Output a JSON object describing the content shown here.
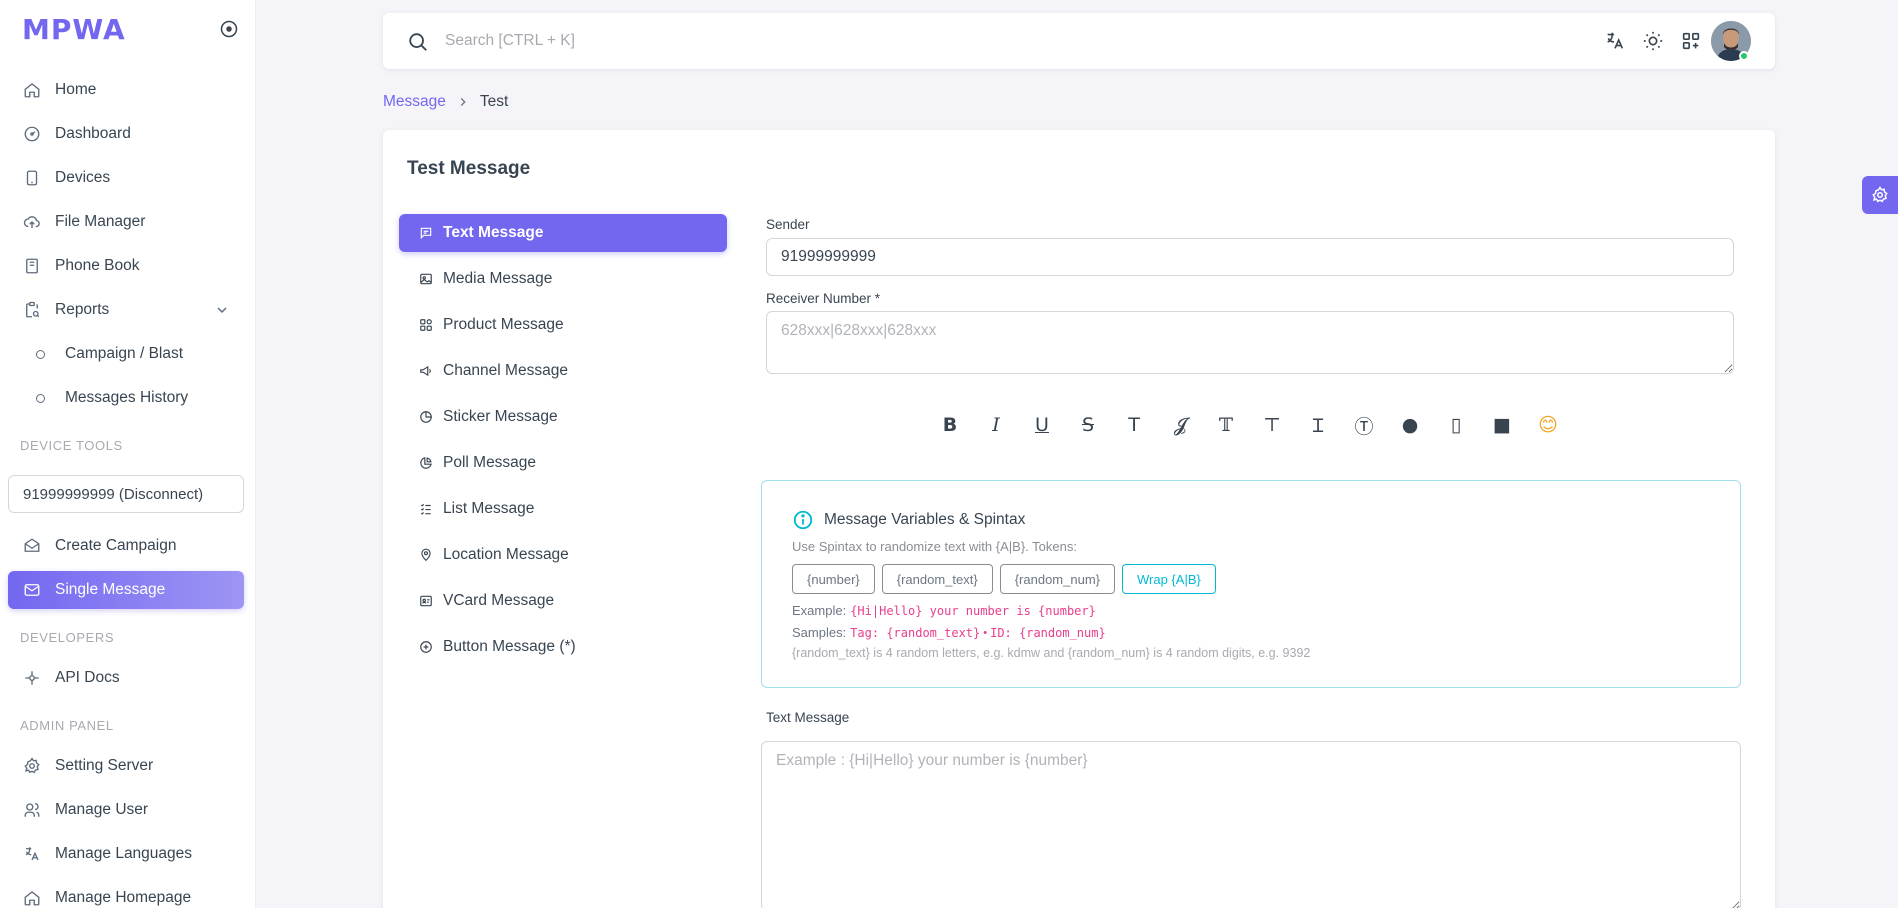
{
  "app": {
    "logo": "MPWA"
  },
  "sidebar": {
    "nav": [
      {
        "label": "Home",
        "icon": "home-icon"
      },
      {
        "label": "Dashboard",
        "icon": "dashboard-icon"
      },
      {
        "label": "Devices",
        "icon": "device-icon"
      },
      {
        "label": "File Manager",
        "icon": "cloud-upload-icon"
      },
      {
        "label": "Phone Book",
        "icon": "book-icon"
      },
      {
        "label": "Reports",
        "icon": "report-icon"
      },
      {
        "label": "Campaign / Blast",
        "icon": "circle-icon"
      },
      {
        "label": "Messages History",
        "icon": "circle-icon"
      }
    ],
    "sections": {
      "device_tools": "DEVICE TOOLS",
      "developers": "DEVELOPERS",
      "admin_panel": "ADMIN PANEL"
    },
    "device_select": "91999999999 (Disconnect)",
    "device_nav": [
      {
        "label": "Create Campaign",
        "icon": "mail-open-icon"
      },
      {
        "label": "Single Message",
        "icon": "mail-icon"
      }
    ],
    "dev_nav": [
      {
        "label": "API Docs",
        "icon": "api-icon"
      }
    ],
    "admin_nav": [
      {
        "label": "Setting Server",
        "icon": "gear-icon"
      },
      {
        "label": "Manage User",
        "icon": "users-icon"
      },
      {
        "label": "Manage Languages",
        "icon": "language-icon"
      },
      {
        "label": "Manage Homepage",
        "icon": "home-icon"
      }
    ]
  },
  "navbar": {
    "search_placeholder": "Search [CTRL + K]"
  },
  "breadcrumb": {
    "parent": "Message",
    "current": "Test"
  },
  "card": {
    "title": "Test Message",
    "tabs": [
      {
        "label": "Text Message",
        "icon": "chat-icon"
      },
      {
        "label": "Media Message",
        "icon": "image-icon"
      },
      {
        "label": "Product Message",
        "icon": "product-icon"
      },
      {
        "label": "Channel Message",
        "icon": "megaphone-icon"
      },
      {
        "label": "Sticker Message",
        "icon": "sticker-icon"
      },
      {
        "label": "Poll Message",
        "icon": "poll-icon"
      },
      {
        "label": "List Message",
        "icon": "list-icon"
      },
      {
        "label": "Location Message",
        "icon": "location-icon"
      },
      {
        "label": "VCard Message",
        "icon": "vcard-icon"
      },
      {
        "label": "Button Message (*)",
        "icon": "plus-circle-icon"
      }
    ],
    "sender_label": "Sender",
    "sender_value": "91999999999",
    "receiver_label": "Receiver Number *",
    "receiver_placeholder": "628xxx|628xxx|628xxx",
    "format_buttons": [
      "B",
      "I",
      "U",
      "S",
      "T",
      "𝓙",
      "𝕋",
      "⊤",
      "Ɪ",
      "Ⓣ",
      "●",
      "▯",
      "■",
      "😊"
    ],
    "variables": {
      "title": "Message Variables & Spintax",
      "description": "Use Spintax to randomize text with {A|B}. Tokens:",
      "tokens": [
        "{number}",
        "{random_text}",
        "{random_num}"
      ],
      "wrap_label": "Wrap {A|B}",
      "example_label": "Example:",
      "example_code": "{Hi|Hello} your number is {number}",
      "samples_label": "Samples:",
      "sample_1": "Tag: {random_text}",
      "sample_sep": "•",
      "sample_2": "ID: {random_num}",
      "note": "{random_text} is 4 random letters, e.g. kdmw and {random_num} is 4 random digits, e.g. 9392"
    },
    "text_message_label": "Text Message",
    "text_message_placeholder": "Example : {Hi|Hello} your number is {number}"
  },
  "colors": {
    "primary": "#7367f0",
    "info": "#00bad1",
    "success": "#28c76f"
  }
}
